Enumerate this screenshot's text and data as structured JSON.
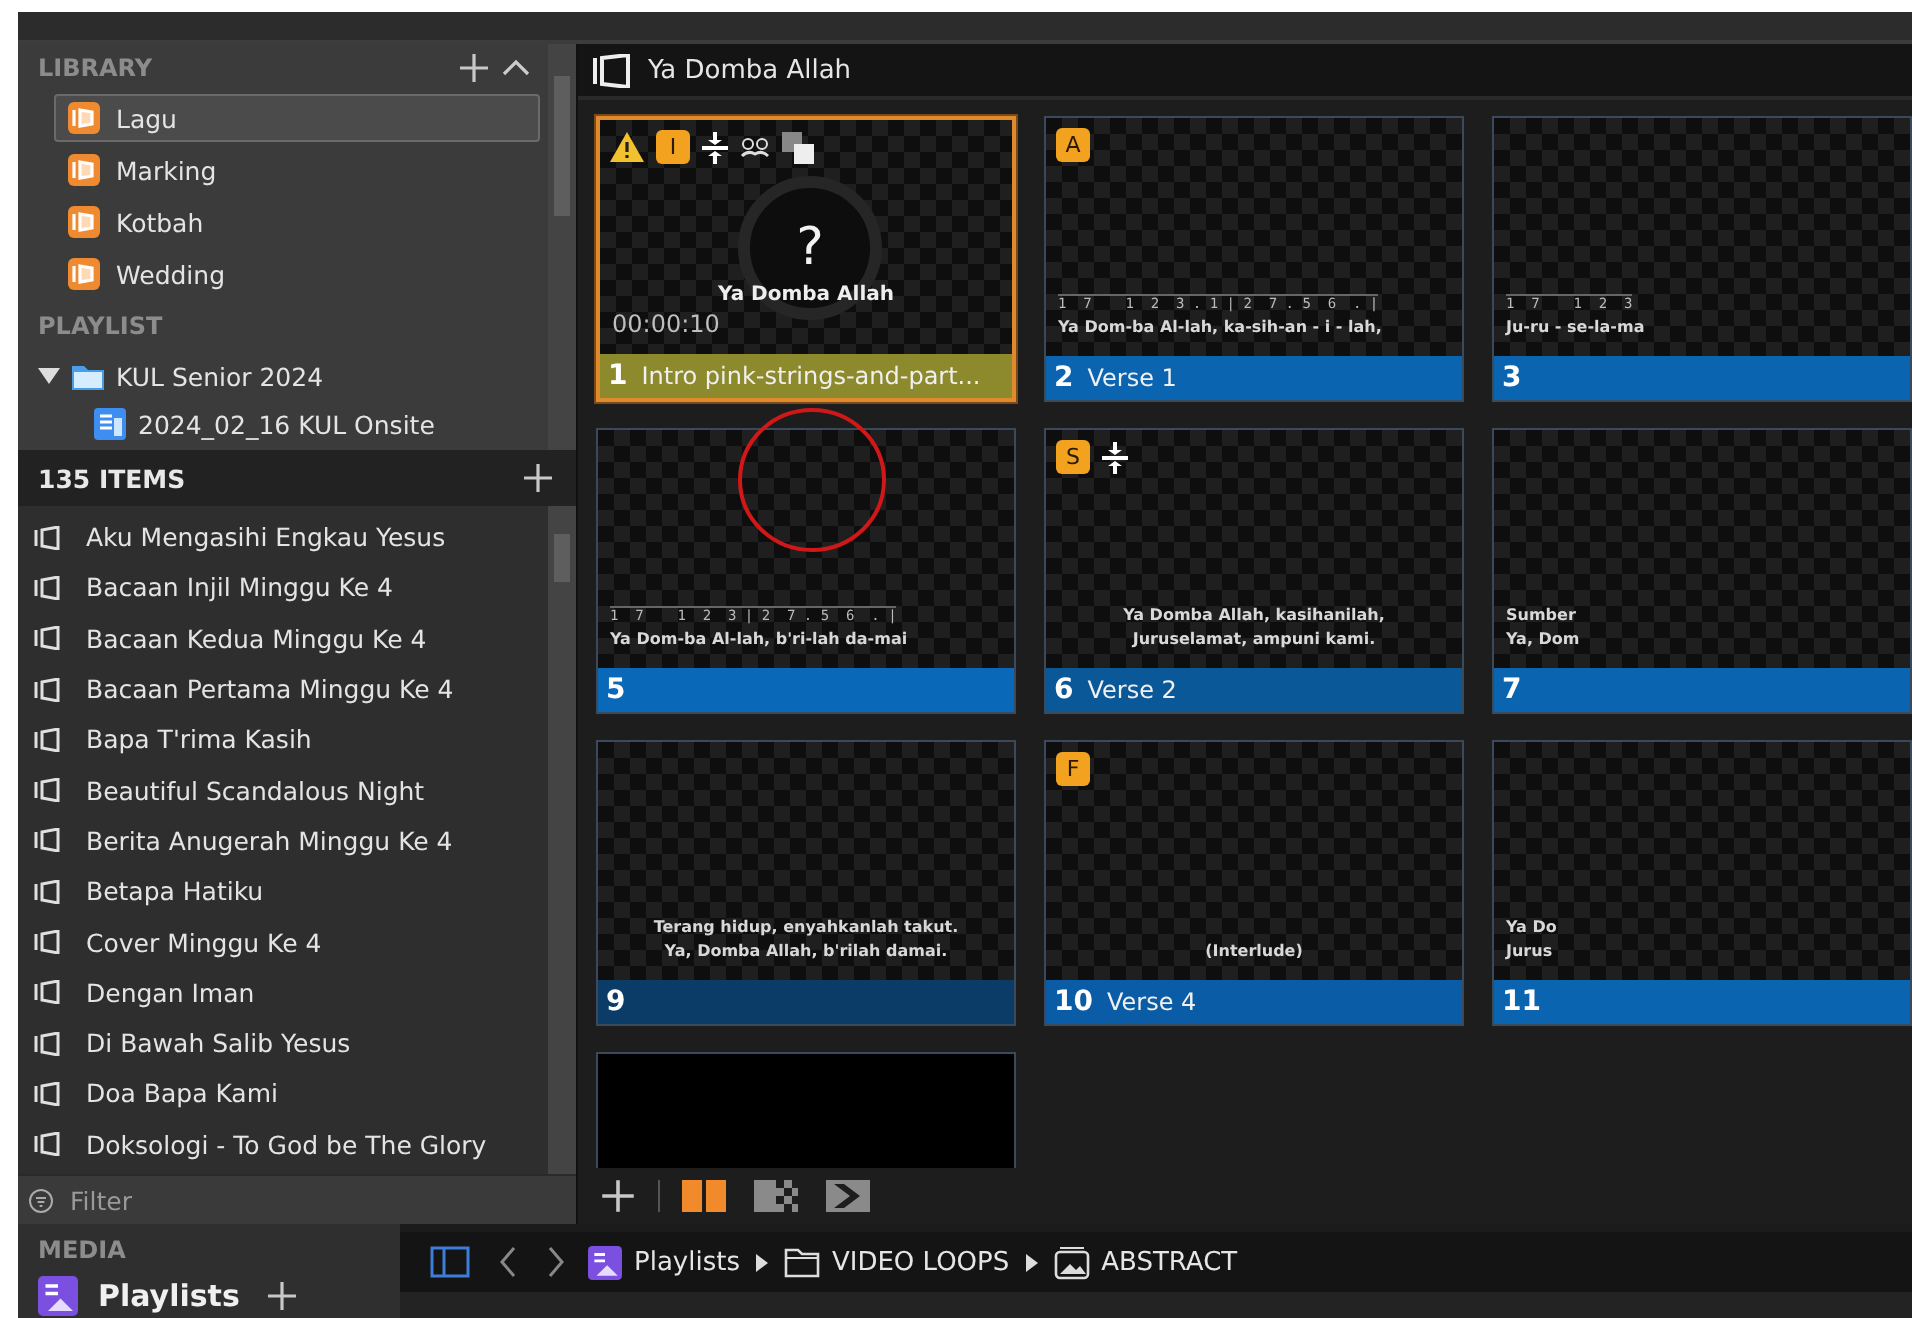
{
  "library": {
    "title": "LIBRARY",
    "items": [
      {
        "label": "Lagu",
        "selected": true
      },
      {
        "label": "Marking",
        "selected": false
      },
      {
        "label": "Kotbah",
        "selected": false
      },
      {
        "label": "Wedding",
        "selected": false
      }
    ]
  },
  "playlist": {
    "title": "PLAYLIST",
    "folders": [
      {
        "label": "KUL Senior 2024",
        "expanded": true,
        "children": [
          {
            "label": "2024_02_16 KUL Onsite"
          }
        ]
      }
    ]
  },
  "items": {
    "count": "135 ITEMS",
    "rows": [
      "Aku Mengasihi Engkau Yesus",
      "Bacaan Injil Minggu Ke 4",
      "Bacaan Kedua Minggu Ke 4",
      "Bacaan Pertama Minggu Ke 4",
      "Bapa T'rima Kasih",
      "Beautiful Scandalous Night",
      "Berita Anugerah Minggu Ke 4",
      "Betapa Hatiku",
      "Cover Minggu Ke 4",
      "Dengan Iman",
      "Di Bawah Salib Yesus",
      "Doa Bapa Kami",
      "Doksologi - To God be The Glory"
    ]
  },
  "filter": {
    "placeholder": "Filter"
  },
  "media": {
    "title": "MEDIA",
    "item": "Playlists"
  },
  "presentation": {
    "title": "Ya Domba Allah",
    "slides": [
      {
        "kind": "media",
        "number": "1",
        "label": "Intro  pink-strings-and-part...",
        "selected": true,
        "color": "#8c8a2c",
        "markers": [
          {
            "kind": "warning"
          },
          {
            "kind": "badge",
            "text": "I"
          },
          {
            "kind": "split"
          },
          {
            "kind": "mask"
          },
          {
            "kind": "layers"
          }
        ],
        "symbol": "?",
        "caption": "Ya Domba Allah",
        "timer": "00:00:10"
      },
      {
        "kind": "lyric",
        "number": "2",
        "label": "Verse 1",
        "selected": false,
        "color": "#0a64b0",
        "markers": [
          {
            "kind": "badge",
            "text": "A"
          }
        ],
        "lines": [
          {
            "kind": "notation",
            "text": "1  7    1  2  3 . 1 | 2  7 . 5  6  . |"
          },
          {
            "kind": "text",
            "text": "Ya Dom-ba Al-lah,  ka-sih-an - i - lah,"
          }
        ]
      },
      {
        "kind": "lyric",
        "number": "3",
        "selected": false,
        "color": "#0a64b0",
        "lines": [
          {
            "kind": "notation",
            "text": "1  7    1  2  3"
          },
          {
            "kind": "text",
            "text": "Ju-ru - se-la-ma"
          }
        ]
      },
      {
        "kind": "lyric",
        "number": "5",
        "selected": false,
        "color": "#0a68b8",
        "lines": [
          {
            "kind": "notation",
            "text": "1  7    1  2  3 | 2  7 . 5  6  . |"
          },
          {
            "kind": "text",
            "text": "Ya Dom-ba Al-lah,  b'ri-lah da-mai"
          }
        ]
      },
      {
        "kind": "lyric",
        "number": "6",
        "label": "Verse 2",
        "selected": false,
        "color": "#0b5899",
        "markers": [
          {
            "kind": "badge",
            "text": "S"
          },
          {
            "kind": "split"
          }
        ],
        "lines": [
          {
            "kind": "text",
            "text": "Ya Domba Allah, kasihanilah,"
          },
          {
            "kind": "text",
            "text": "Juruselamat, ampuni kami."
          }
        ]
      },
      {
        "kind": "lyric",
        "number": "7",
        "selected": false,
        "color": "#0a64b0",
        "lines": [
          {
            "kind": "text",
            "text": "Sumber"
          },
          {
            "kind": "text",
            "text": "Ya, Dom"
          }
        ]
      },
      {
        "kind": "lyric",
        "number": "9",
        "selected": false,
        "color": "#0b3c68",
        "lines": [
          {
            "kind": "text",
            "text": "Terang hidup, enyahkanlah takut."
          },
          {
            "kind": "text",
            "text": "Ya, Domba Allah, b'rilah damai."
          }
        ]
      },
      {
        "kind": "lyric",
        "number": "10",
        "label": "Verse 4",
        "selected": false,
        "color": "#0a5ca6",
        "markers": [
          {
            "kind": "badge",
            "text": "F"
          }
        ],
        "lines": [
          {
            "kind": "text",
            "text": "(Interlude)"
          }
        ]
      },
      {
        "kind": "lyric",
        "number": "11",
        "selected": false,
        "color": "#0a64b0",
        "lines": [
          {
            "kind": "text",
            "text": "Ya Do"
          },
          {
            "kind": "text",
            "text": "Jurus"
          }
        ]
      },
      {
        "kind": "blank",
        "selected": false
      }
    ]
  },
  "breadcrumb": [
    {
      "kind": "playlist",
      "label": "Playlists"
    },
    {
      "kind": "folder",
      "label": "VIDEO LOOPS"
    },
    {
      "kind": "media",
      "label": "ABSTRACT"
    }
  ]
}
